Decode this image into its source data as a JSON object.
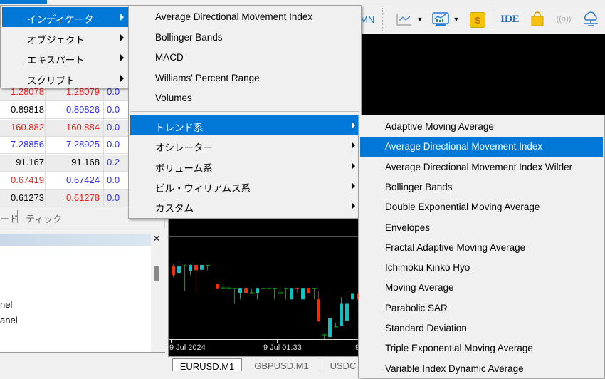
{
  "toolbar": {
    "timeframe_mn": "MN",
    "ide_label": "IDE",
    "icons": [
      "line-chart-icon",
      "dropdown-arrow-icon",
      "indicators-icon",
      "dropdown-arrow-icon",
      "market-dollar-icon",
      "ide-icon",
      "shopping-bag-icon",
      "signals-icon",
      "vps-cloud-icon"
    ]
  },
  "menu_level1": {
    "items": [
      {
        "label": "インディケータ",
        "submenu": true,
        "highlighted": true
      },
      {
        "label": "オブジェクト",
        "submenu": true
      },
      {
        "label": "エキスパート",
        "submenu": true
      },
      {
        "label": "スクリプト",
        "submenu": true
      }
    ]
  },
  "menu_level2": {
    "favorites": [
      {
        "label": "Average Directional Movement Index"
      },
      {
        "label": "Bollinger Bands"
      },
      {
        "label": "MACD"
      },
      {
        "label": "Williams' Percent Range"
      },
      {
        "label": "Volumes"
      }
    ],
    "categories": [
      {
        "label": "トレンド系",
        "submenu": true,
        "highlighted": true
      },
      {
        "label": "オシレーター",
        "submenu": true
      },
      {
        "label": "ボリューム系",
        "submenu": true
      },
      {
        "label": "ビル・ウィリアムス系",
        "submenu": true
      },
      {
        "label": "カスタム",
        "submenu": true
      }
    ]
  },
  "menu_level3": {
    "items": [
      {
        "label": "Adaptive Moving Average"
      },
      {
        "label": "Average Directional Movement Index",
        "highlighted": true
      },
      {
        "label": "Average Directional Movement Index Wilder"
      },
      {
        "label": "Bollinger Bands"
      },
      {
        "label": "Double Exponential Moving Average"
      },
      {
        "label": "Envelopes"
      },
      {
        "label": "Fractal Adaptive Moving Average"
      },
      {
        "label": "Ichimoku Kinko Hyo"
      },
      {
        "label": "Moving Average"
      },
      {
        "label": "Parabolic SAR"
      },
      {
        "label": "Standard Deviation"
      },
      {
        "label": "Triple Exponential Moving Average"
      },
      {
        "label": "Variable Index Dynamic Average"
      }
    ]
  },
  "market_watch": {
    "rows": [
      {
        "bid": "1.28078",
        "ask": "1.28079",
        "spread": "0.0",
        "bid_color": "red",
        "ask_color": "red"
      },
      {
        "bid": "0.89818",
        "ask": "0.89826",
        "spread": "0.0",
        "bid_color": "black",
        "ask_color": "blue"
      },
      {
        "bid": "160.882",
        "ask": "160.884",
        "spread": "0.0",
        "bid_color": "red",
        "ask_color": "red"
      },
      {
        "bid": "7.28856",
        "ask": "7.28925",
        "spread": "0.0",
        "bid_color": "blue",
        "ask_color": "blue"
      },
      {
        "bid": "91.167",
        "ask": "91.168",
        "spread": "0.2",
        "bid_color": "black",
        "ask_color": "black"
      },
      {
        "bid": "0.67419",
        "ask": "0.67424",
        "spread": "0.0",
        "bid_color": "red",
        "ask_color": "blue"
      },
      {
        "bid": "0.61273",
        "ask": "0.61278",
        "spread": "0.0",
        "bid_color": "black",
        "ask_color": "red"
      }
    ],
    "tabs": {
      "symbols": "ード",
      "tick": "ティック"
    }
  },
  "navigator": {
    "close_label": "×",
    "items": [
      "nel",
      "anel"
    ]
  },
  "chart": {
    "x_ticks": [
      "9 Jul 2024",
      "9 Jul 01:33",
      "9 J"
    ],
    "tabs": [
      "EURUSD.M1",
      "GBPUSD.M1",
      "USDC"
    ],
    "colors": {
      "bull": "#00c8c8",
      "bear": "#ff2a00",
      "doji": "#00a000",
      "axis": "#dddddd"
    },
    "candles": [
      {
        "o": 6,
        "c": 4,
        "h": 6.5,
        "l": 3.5
      },
      {
        "o": 4.5,
        "c": 6,
        "h": 7,
        "l": 4.5
      },
      {
        "o": 6.2,
        "c": 6.1,
        "h": 6.4,
        "l": 0.5
      },
      {
        "o": 5,
        "c": 6.3,
        "h": 6.4,
        "l": 4
      },
      {
        "o": 6.3,
        "c": 5.1,
        "h": 6.3,
        "l": 0
      },
      {
        "o": 5.2,
        "c": 6.3,
        "h": 6.3,
        "l": 5.2
      },
      {
        "o": 6.3,
        "c": 6.2,
        "h": 6.3,
        "l": 5.1
      },
      {
        "o": 2,
        "c": 1,
        "h": 2,
        "l": 1
      },
      {
        "o": 1.2,
        "c": 1.1,
        "h": 2.2,
        "l": 0
      },
      {
        "o": 1.2,
        "c": 1.1,
        "h": 1.2,
        "l": 1.1
      },
      {
        "o": 1.1,
        "c": 1.0,
        "h": 1.1,
        "l": -2.5
      },
      {
        "o": 0,
        "c": 1.1,
        "h": 1.1,
        "l": -1.5
      },
      {
        "o": 1.1,
        "c": 0,
        "h": 1.1,
        "l": 0
      },
      {
        "o": 0,
        "c": 0.1,
        "h": 1,
        "l": 0
      },
      {
        "o": 0,
        "c": 1.1,
        "h": 1.1,
        "l": -1.5
      },
      {
        "o": 1.1,
        "c": 1.0,
        "h": 1.1,
        "l": 1.0
      },
      {
        "o": 1.1,
        "c": 1.0,
        "h": 1.1,
        "l": 1.0
      },
      {
        "o": 1.1,
        "c": 1.0,
        "h": 1.1,
        "l": -1.5
      },
      {
        "o": 0.1,
        "c": 0.0,
        "h": 1.2,
        "l": -1.2
      },
      {
        "o": 1.1,
        "c": 1.0,
        "h": 1.1,
        "l": -1.5
      },
      {
        "o": -1.5,
        "c": 1.1,
        "h": 1.1,
        "l": -1.5
      },
      {
        "o": 1.1,
        "c": 0.9,
        "h": 1.1,
        "l": 0
      },
      {
        "o": -1.5,
        "c": 1.1,
        "h": 1.1,
        "l": -1.5
      },
      {
        "o": 1.1,
        "c": 0,
        "h": 1.1,
        "l": 0
      },
      {
        "o": 1.1,
        "c": 1.0,
        "h": 1.1,
        "l": -1.5
      },
      {
        "o": -1.5,
        "c": -6.5,
        "h": 0.5,
        "l": -6.5
      },
      {
        "o": -9.5,
        "c": -9.4,
        "h": -9.4,
        "l": -10.5
      },
      {
        "o": -10,
        "c": -5.8,
        "h": -5.8,
        "l": -11
      },
      {
        "o": -7.7,
        "c": -7.6,
        "h": -6.8,
        "l": -7.7
      },
      {
        "o": -7.5,
        "c": -2.5,
        "h": -1,
        "l": -7.5
      },
      {
        "o": -6.3,
        "c": -2.5,
        "h": -1,
        "l": -6.3
      },
      {
        "o": -1.5,
        "c": -0.1,
        "h": -0.1,
        "l": -1.5
      },
      {
        "o": -0.1,
        "c": -1.5,
        "h": -0.1,
        "l": -1.5
      },
      {
        "o": -3.5,
        "c": -6,
        "h": -3.5,
        "l": -7
      }
    ]
  }
}
